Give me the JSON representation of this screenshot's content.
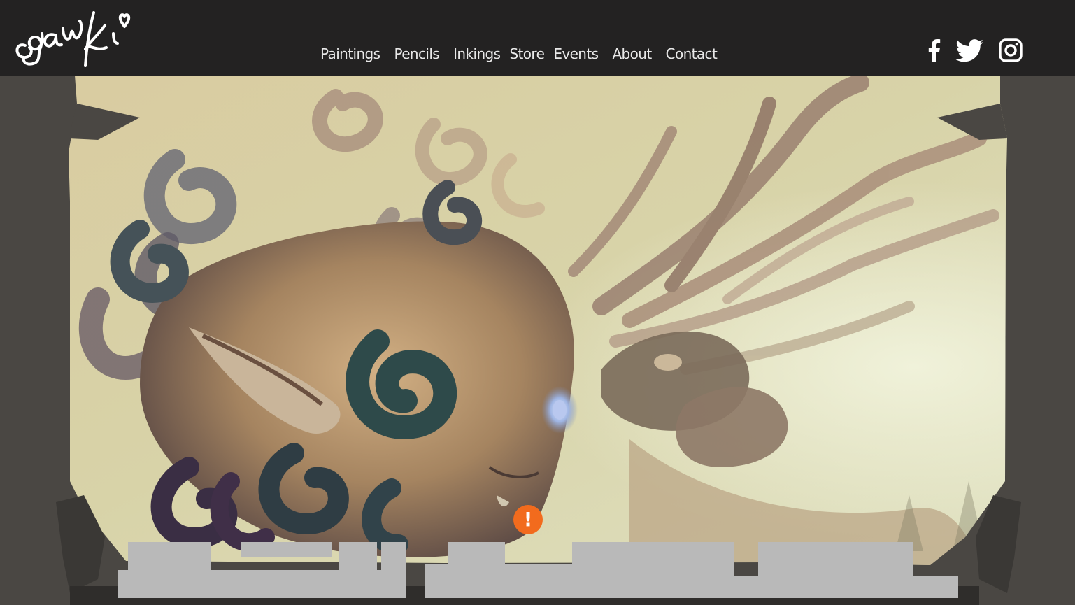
{
  "brand": {
    "logo_text": "gawki",
    "logo_color": "#ffffff"
  },
  "nav": {
    "items": [
      {
        "label": "Paintings"
      },
      {
        "label": "Pencils"
      },
      {
        "label": "Inkings"
      },
      {
        "label": "Store"
      },
      {
        "label": "Events"
      },
      {
        "label": "About"
      },
      {
        "label": "Contact"
      }
    ]
  },
  "social": [
    {
      "icon": "facebook-icon"
    },
    {
      "icon": "twitter-icon"
    },
    {
      "icon": "instagram-icon"
    }
  ],
  "hero": {
    "image": "surreal-painting-of-curled-horn-creatures"
  },
  "warning": {
    "icon": "exclamation-icon",
    "symbol": "!",
    "color": "#f26b1d"
  },
  "colors": {
    "header_bg": "#232222",
    "page_bg": "#4a4743",
    "nav_text": "#e9e9e9",
    "placeholder_block": "#b9b9b9"
  }
}
